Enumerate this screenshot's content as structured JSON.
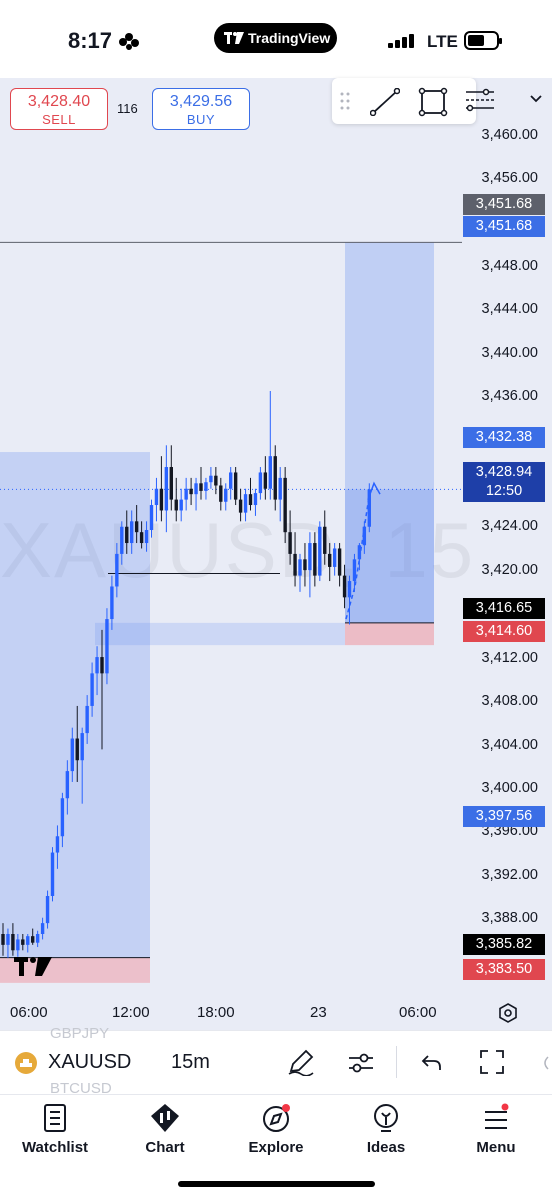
{
  "status_bar": {
    "time": "8:17",
    "network": "LTE",
    "app_pill": "TradingView"
  },
  "trade": {
    "sell_price": "3,428.40",
    "sell_label": "SELL",
    "spread": "116",
    "buy_price": "3,429.56",
    "buy_label": "BUY"
  },
  "drawing_toolbar": {
    "tools": [
      "drag-handle-icon",
      "trend-line-icon",
      "rectangle-icon",
      "fib-retracement-icon"
    ]
  },
  "price_axis": {
    "ticks": [
      "3,460.00",
      "3,456.00",
      "3,448.00",
      "3,444.00",
      "3,440.00",
      "3,436.00",
      "3,424.00",
      "3,420.00",
      "3,412.00",
      "3,408.00",
      "3,404.00",
      "3,400.00",
      "3,396.00",
      "3,392.00",
      "3,388.00"
    ],
    "labels": [
      {
        "text": "3,451.68",
        "color": "#5d606b"
      },
      {
        "text": "3,451.68",
        "color": "#3b6ee6"
      },
      {
        "text": "3,432.38",
        "color": "#3b6ee6"
      },
      {
        "text": "3,428.94",
        "sub": "12:50",
        "color": "#1e3fa8"
      },
      {
        "text": "3,416.65",
        "color": "#000000"
      },
      {
        "text": "3,414.60",
        "color": "#e0474f"
      },
      {
        "text": "3,397.56",
        "color": "#3b6ee6"
      },
      {
        "text": "3,385.82",
        "color": "#000000"
      },
      {
        "text": "3,383.50",
        "color": "#e0474f"
      }
    ]
  },
  "time_axis": {
    "ticks": [
      "06:00",
      "12:00",
      "18:00",
      "23",
      "06:00"
    ]
  },
  "watermark": "XAUUSD, 15",
  "symbol_bar": {
    "prev_symbol": "GBPJPY",
    "symbol": "XAUUSD",
    "next_symbol": "BTCUSD",
    "interval": "15m"
  },
  "bottom_nav": {
    "items": [
      {
        "label": "Watchlist",
        "icon": "watchlist-icon"
      },
      {
        "label": "Chart",
        "icon": "chart-icon"
      },
      {
        "label": "Explore",
        "icon": "explore-icon"
      },
      {
        "label": "Ideas",
        "icon": "ideas-icon"
      },
      {
        "label": "Menu",
        "icon": "menu-icon"
      }
    ]
  },
  "colors": {
    "up": "#2962ff",
    "down": "#131722",
    "accent": "#3b6ee6",
    "sell": "#e0474f"
  }
}
